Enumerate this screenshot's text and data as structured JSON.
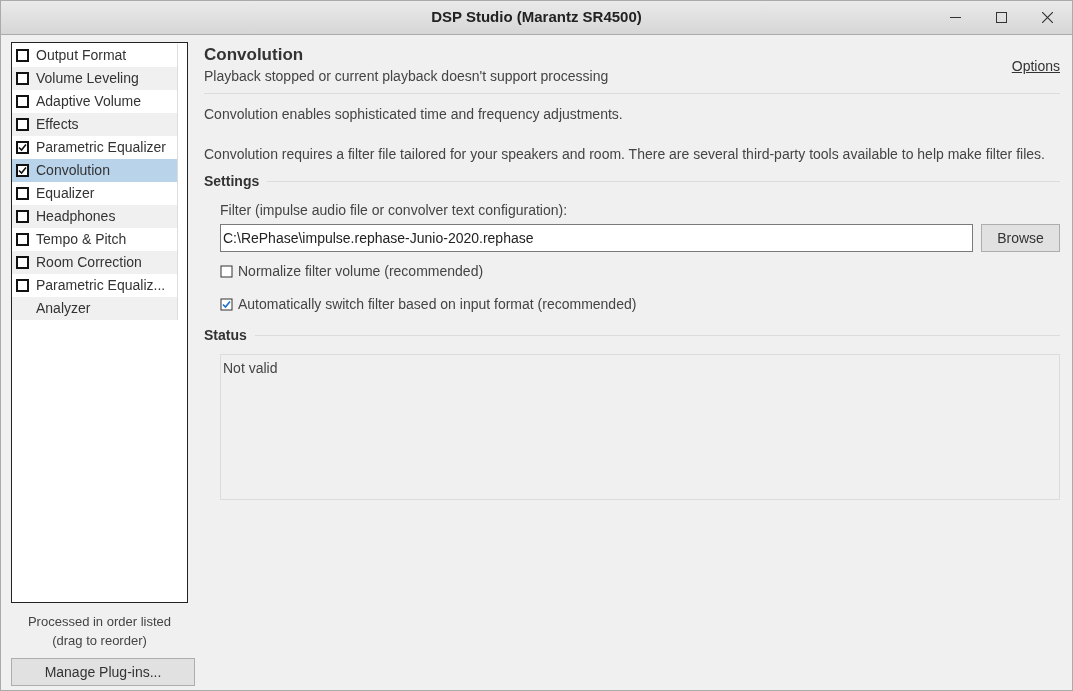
{
  "window": {
    "title": "DSP Studio (Marantz SR4500)"
  },
  "plugins": [
    {
      "kind": "checkbox",
      "label": "Output Format",
      "checked": false,
      "selected": false
    },
    {
      "kind": "checkbox",
      "label": "Volume Leveling",
      "checked": false,
      "selected": false
    },
    {
      "kind": "checkbox",
      "label": "Adaptive Volume",
      "checked": false,
      "selected": false
    },
    {
      "kind": "checkbox",
      "label": "Effects",
      "checked": false,
      "selected": false
    },
    {
      "kind": "checkbox",
      "label": "Parametric Equalizer",
      "checked": true,
      "selected": false
    },
    {
      "kind": "checkbox",
      "label": "Convolution",
      "checked": true,
      "selected": true
    },
    {
      "kind": "checkbox",
      "label": "Equalizer",
      "checked": false,
      "selected": false
    },
    {
      "kind": "checkbox",
      "label": "Headphones",
      "checked": false,
      "selected": false
    },
    {
      "kind": "checkbox",
      "label": "Tempo & Pitch",
      "checked": false,
      "selected": false
    },
    {
      "kind": "checkbox",
      "label": "Room Correction",
      "checked": false,
      "selected": false
    },
    {
      "kind": "checkbox",
      "label": "Parametric Equaliz...",
      "checked": false,
      "selected": false
    },
    {
      "kind": "plain",
      "label": "Analyzer",
      "selected": false
    }
  ],
  "order_note": [
    "Processed in order listed",
    "(drag to reorder)"
  ],
  "manage_button": "Manage Plug-ins...",
  "header": {
    "title": "Convolution",
    "subtitle": "Playback stopped or current playback doesn't support processing",
    "options_link": "Options"
  },
  "paragraphs": [
    "Convolution enables sophisticated time and frequency adjustments.",
    "Convolution requires a filter file tailored for your speakers and room.  There are several third-party tools available to help make filter files."
  ],
  "settings": {
    "heading": "Settings",
    "filter_label": "Filter (impulse audio file or convolver text configuration):",
    "filter_value": "C:\\RePhase\\impulse.rephase-Junio-2020.rephase",
    "browse_button": "Browse",
    "options": [
      {
        "label": "Normalize filter volume (recommended)",
        "checked": false
      },
      {
        "label": "Automatically switch filter based on input format (recommended)",
        "checked": true
      }
    ]
  },
  "status": {
    "heading": "Status",
    "text": "Not valid"
  }
}
